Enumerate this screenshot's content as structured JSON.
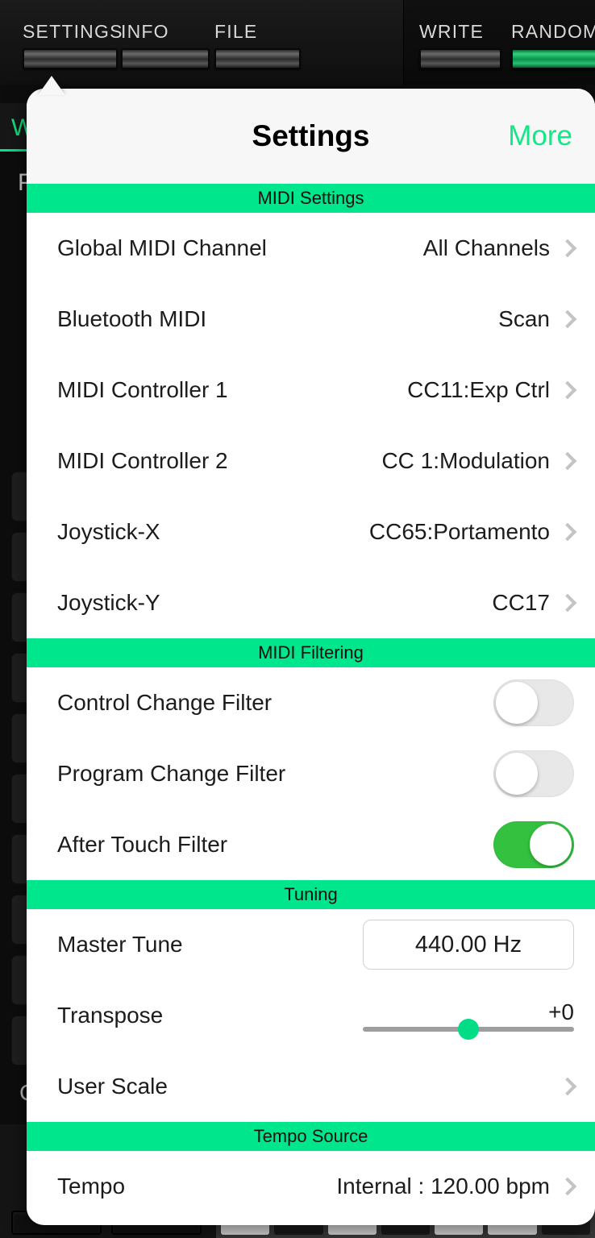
{
  "background": {
    "toolbar_buttons": [
      {
        "label": "SETTINGS",
        "lit": false
      },
      {
        "label": "INFO",
        "lit": false
      },
      {
        "label": "FILE",
        "lit": false
      },
      {
        "label": "WRITE",
        "lit": false
      },
      {
        "label": "RANDOM",
        "lit": true
      }
    ],
    "tab_label": "W",
    "sub_label": "P",
    "corner_label": "C"
  },
  "popover": {
    "title": "Settings",
    "more_label": "More",
    "sections": [
      {
        "header": "MIDI Settings",
        "rows": [
          {
            "label": "Global MIDI Channel",
            "value": "All Channels",
            "type": "nav"
          },
          {
            "label": "Bluetooth MIDI",
            "value": "Scan",
            "type": "nav"
          },
          {
            "label": "MIDI Controller 1",
            "value": "CC11:Exp Ctrl",
            "type": "nav"
          },
          {
            "label": "MIDI Controller 2",
            "value": "CC 1:Modulation",
            "type": "nav"
          },
          {
            "label": "Joystick-X",
            "value": "CC65:Portamento",
            "type": "nav"
          },
          {
            "label": "Joystick-Y",
            "value": "CC17",
            "type": "nav"
          }
        ]
      },
      {
        "header": "MIDI Filtering",
        "rows": [
          {
            "label": "Control Change Filter",
            "type": "toggle",
            "on": false
          },
          {
            "label": "Program Change Filter",
            "type": "toggle",
            "on": false
          },
          {
            "label": "After Touch Filter",
            "type": "toggle",
            "on": true
          }
        ]
      },
      {
        "header": "Tuning",
        "rows": [
          {
            "label": "Master Tune",
            "type": "field",
            "value": "440.00  Hz"
          },
          {
            "label": "Transpose",
            "type": "slider",
            "value": "+0",
            "position_pct": 50
          },
          {
            "label": "User Scale",
            "type": "nav",
            "value": ""
          }
        ]
      },
      {
        "header": "Tempo Source",
        "rows": [
          {
            "label": "Tempo",
            "value": "Internal : 120.00 bpm",
            "type": "nav"
          }
        ]
      }
    ]
  },
  "colors": {
    "accent_green": "#00e68c",
    "toggle_on_green": "#34c13f",
    "slider_thumb_green": "#00dd84",
    "more_link_green": "#12e887"
  }
}
